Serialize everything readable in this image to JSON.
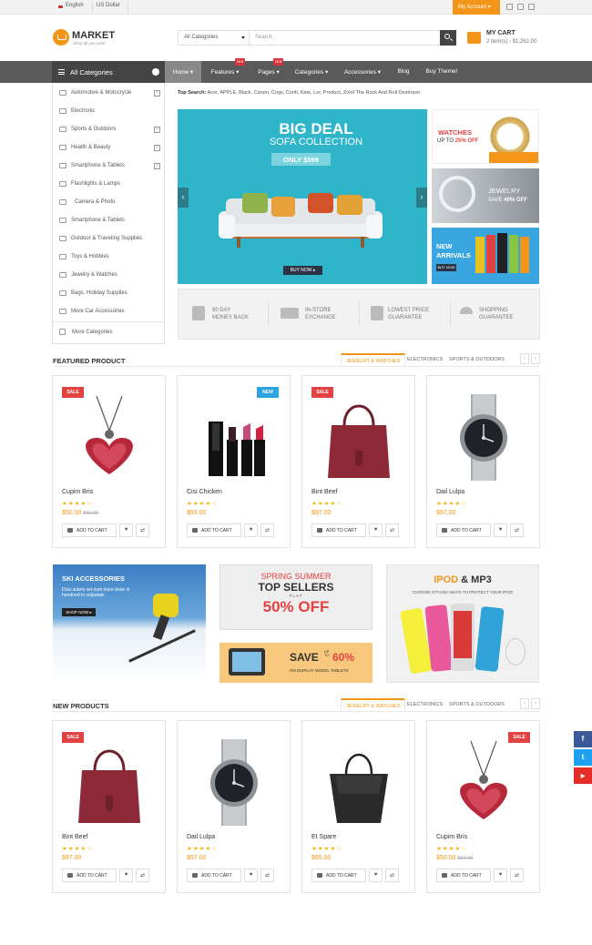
{
  "topbar": {
    "language": "English",
    "currency": "US Dollar",
    "account": "My Account"
  },
  "brand": {
    "name": "MARKET",
    "tagline": "Shop all you want"
  },
  "search": {
    "category": "All Categories",
    "placeholder": "Search"
  },
  "cart": {
    "title": "MY CART",
    "summary": "2 item(s) - $1,262.00"
  },
  "nav": {
    "all_categories": "All Categories",
    "items": [
      "Home",
      "Features",
      "Pages",
      "Categories",
      "Accessories",
      "Blog",
      "Buy Theme!"
    ],
    "hot": "Hot"
  },
  "sidebar": {
    "items": [
      "Automotive & Motocrycle",
      "Electronic",
      "Sports & Outdoors",
      "Health & Beauty",
      "Smartphone & Tablets",
      "Flashlights & Lamps",
      "Camera & Photo",
      "Smartphone & Tablets",
      "Outdoor & Traveling Supplies",
      "Toys & Hobbies",
      "Jewelry & Watches",
      "Bags, Holiday Supplies",
      "More Car Accessories",
      "More Categories"
    ]
  },
  "top_search": {
    "label": "Top Search:",
    "terms": "Acer, APPLE, Black, Canon, Cogs, Confi, Kate, Lor, Product, Zolof The Rock And Roll Destroyer"
  },
  "hero": {
    "line1": "BIG DEAL",
    "line2": "SOFA COLLECTION",
    "price": "ONLY $599",
    "cta": "BUY NOW ▸"
  },
  "side_banners": {
    "watches": {
      "title": "WATCHES",
      "sub": "UP TO",
      "pct": "25% OFF"
    },
    "jewelry": {
      "title": "JEWELRY",
      "sub": "SAVE",
      "pct": "40% OFF"
    },
    "arrivals": {
      "title1": "NEW",
      "title2": "ARRIVALS",
      "cta": "BUY NOW"
    }
  },
  "promos": [
    {
      "l1": "90 DAY",
      "l2": "MONEY BACK"
    },
    {
      "l1": "IN-STORE",
      "l2": "EXCHANGE"
    },
    {
      "l1": "LOWEST PRICE",
      "l2": "GUARANTEE"
    },
    {
      "l1": "SHOPPING",
      "l2": "GUARANTEE"
    }
  ],
  "featured": {
    "title": "FEATURED PRODUCT",
    "tabs": [
      "JEWELRY & WATCHES",
      "ELECTRONICS",
      "SPORTS & OUTDOORS"
    ],
    "products": [
      {
        "name": "Cupim Bris",
        "price": "$50.00",
        "old": "$62.00",
        "badge": "SALE"
      },
      {
        "name": "Cisi Chicken",
        "price": "$59.00",
        "old": "",
        "badge": "NEW"
      },
      {
        "name": "Bint Beef",
        "price": "$97.00",
        "old": "",
        "badge": "SALE"
      },
      {
        "name": "Dail Lulpa",
        "price": "$97.00",
        "old": "",
        "badge": ""
      }
    ]
  },
  "mid_banners": {
    "ski": {
      "title": "SKI ACCESSORIES",
      "body": "Duis autem vel eum iriure dolor in hendrerit in vulputate",
      "cta": "SHOP NOW ▸"
    },
    "spring": {
      "l1": "SPRING SUMMER",
      "l2": "TOP SELLERS",
      "flat": "FLAT",
      "off": "50% OFF"
    },
    "tablets": {
      "save": "SAVE",
      "upto": "UP TO",
      "pct": "60%",
      "sub": "ON DISPLAY MODEL TABLETS"
    },
    "ipod": {
      "title_a": "IPOD",
      "title_b": "& MP3",
      "sub": "CHOOSE STYLISH WAYS TO PROTECT YOUR IPOD"
    }
  },
  "new_products": {
    "title": "NEW PRODUCTS",
    "tabs": [
      "JEWELRY & WATCHES",
      "ELECTRONICS",
      "SPORTS & OUTDOORS"
    ],
    "products": [
      {
        "name": "Bint Beef",
        "price": "$97.00",
        "old": "",
        "badge": "SALE"
      },
      {
        "name": "Dail Lulpa",
        "price": "$97.00",
        "old": "",
        "badge": ""
      },
      {
        "name": "Et Spare",
        "price": "$65.00",
        "old": "",
        "badge": ""
      },
      {
        "name": "Cupim Bris",
        "price": "$50.00",
        "old": "$62.00",
        "badge": "SALE"
      }
    ]
  },
  "buttons": {
    "add_to_cart": "ADD TO CART",
    "wishlist": "♥",
    "compare": "⇄",
    "stars": "★★★★☆",
    "prev": "‹",
    "next": "›"
  },
  "social": {
    "facebook": "f",
    "twitter": "t",
    "youtube": "▶"
  },
  "colors": {
    "accent": "#f39519",
    "hero": "#2fb5c9",
    "sale": "#e34242",
    "new": "#2ea3df"
  }
}
